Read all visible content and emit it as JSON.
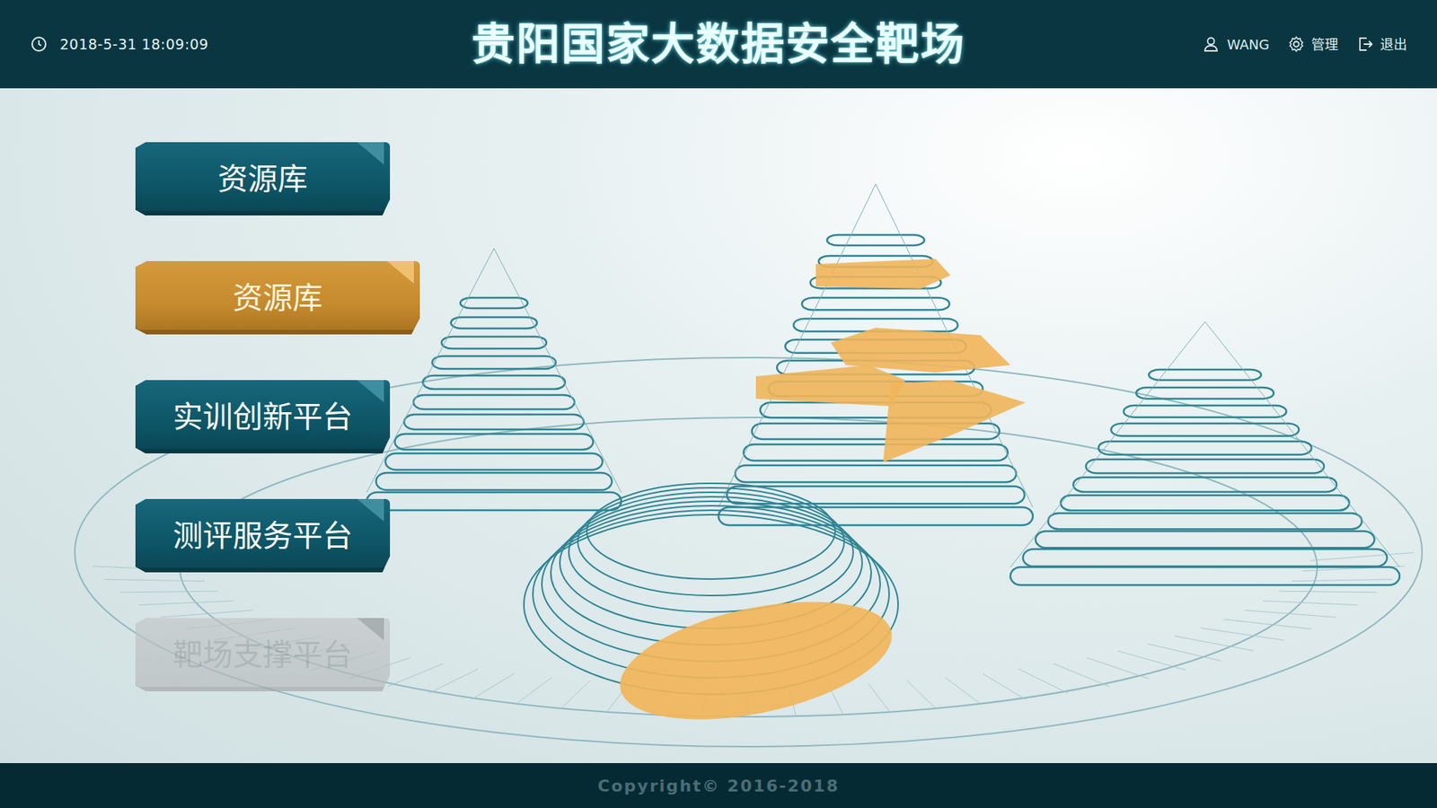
{
  "header": {
    "datetime": "2018-5-31 18:09:09",
    "title": "贵阳国家大数据安全靶场",
    "user": "WANG",
    "admin": "管理",
    "logout": "退出"
  },
  "menu": [
    {
      "label": "资源库",
      "selected": false,
      "disabled": false
    },
    {
      "label": "资源库",
      "selected": true,
      "disabled": false
    },
    {
      "label": "实训创新平台",
      "selected": false,
      "disabled": false
    },
    {
      "label": "测评服务平台",
      "selected": false,
      "disabled": false
    },
    {
      "label": "靶场支撑平台",
      "selected": false,
      "disabled": true
    }
  ],
  "footer": {
    "copyright": "Copyright© 2016-2018"
  }
}
